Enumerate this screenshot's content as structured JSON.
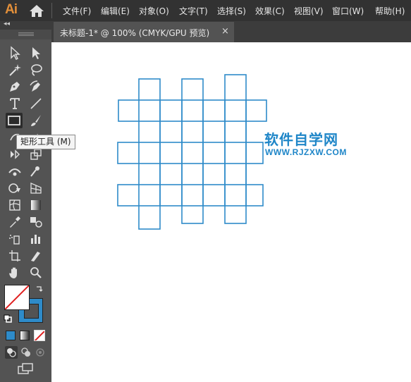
{
  "app": {
    "logo": "Ai"
  },
  "menu": [
    "文件(F)",
    "编辑(E)",
    "对象(O)",
    "文字(T)",
    "选择(S)",
    "效果(C)",
    "视图(V)",
    "窗口(W)",
    "帮助(H)"
  ],
  "document_tab": {
    "title": "未标题-1* @ 100% (CMYK/GPU 预览)",
    "close": "×"
  },
  "panel": {
    "collapse": "◂◂"
  },
  "tooltip": {
    "text": "矩形工具 (M)"
  },
  "watermark": {
    "title": "软件自学网",
    "url": "WWW.RJZXW.COM"
  },
  "colors": {
    "stroke": "#2E8BC9",
    "artwork": "#2E8BC9",
    "watermark": "#1f86c8",
    "logo": "#E28F3A"
  },
  "tools": [
    "selection-tool",
    "direct-selection-tool",
    "magic-wand-tool",
    "lasso-tool",
    "pen-tool",
    "curvature-tool",
    "type-tool",
    "line-segment-tool",
    "rectangle-tool",
    "paintbrush-tool",
    "shaper-tool",
    "eraser-tool",
    "rotate-tool",
    "scale-tool",
    "width-tool",
    "puppet-warp-tool",
    "shape-builder-tool",
    "perspective-grid-tool",
    "mesh-tool",
    "gradient-tool",
    "eyedropper-tool",
    "blend-tool",
    "symbol-sprayer-tool",
    "column-graph-tool",
    "artboard-tool",
    "slice-tool",
    "hand-tool",
    "zoom-tool"
  ],
  "active_tool": "rectangle-tool"
}
